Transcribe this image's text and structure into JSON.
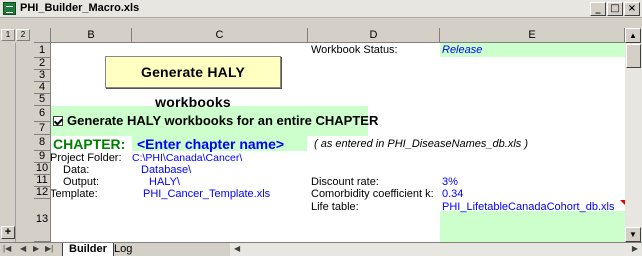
{
  "window": {
    "title": "PHI_Builder_Macro.xls",
    "minimize": "_",
    "restore": "□",
    "close": "×"
  },
  "outline_levels": [
    "1",
    "2"
  ],
  "columns": [
    "B",
    "C",
    "D",
    "E"
  ],
  "rows": [
    "1",
    "2",
    "3",
    "4",
    "5",
    "6",
    "7",
    "8",
    "9",
    "10",
    "11",
    "12",
    "13"
  ],
  "sheet": {
    "workbook_status_label": "Workbook Status:",
    "workbook_status_value": "Release",
    "generate_button": "Generate HALY workbooks",
    "generate_chapter_checkbox": "Generate  HALY workbooks for an entire CHAPTER",
    "chapter_label": "CHAPTER:",
    "chapter_value": "<Enter chapter name>",
    "chapter_note": "( as entered in PHI_DiseaseNames_db.xls )",
    "project_folder_label": "Project Folder:",
    "project_folder_value": "C:\\PHI\\Canada\\Cancer\\",
    "data_label": "Data:",
    "data_value": "Database\\",
    "output_label": "Output:",
    "output_value": "HALY\\",
    "template_label": "Template:",
    "template_value": "PHI_Cancer_Template.xls",
    "discount_label": "Discount rate:",
    "discount_value": "3%",
    "comorbidity_label": "Comorbidity coefficient k:",
    "comorbidity_value": "0.34",
    "life_table_label": "Life table:",
    "life_table_value": "PHI_LifetableCanadaCohort_db.xls"
  },
  "tabs": {
    "active": "Builder",
    "other": "Log"
  },
  "colors": {
    "green_fill": "#ccffcc",
    "button_fill": "#ffffc0",
    "link_blue": "#0000ff",
    "chapter_green": "#008000"
  }
}
